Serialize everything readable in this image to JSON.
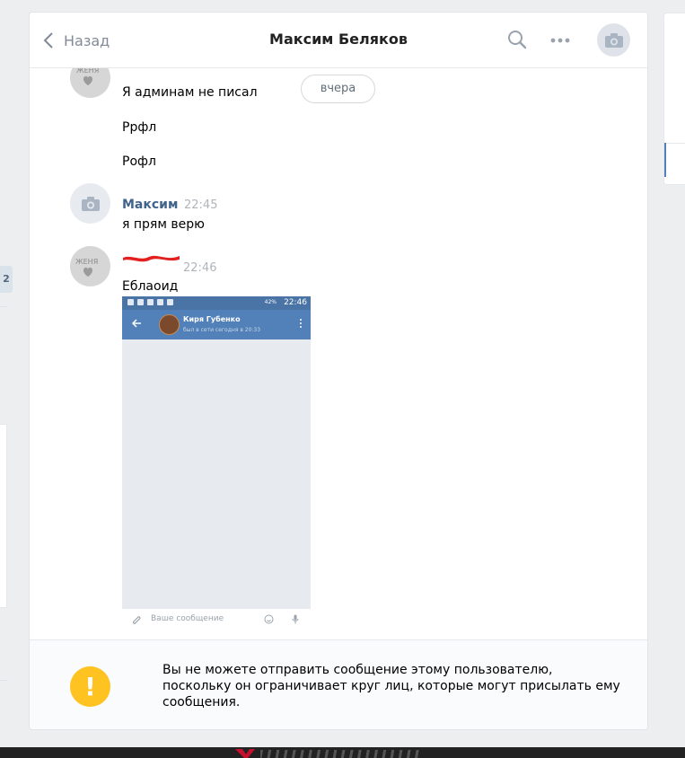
{
  "sidebar_left": {
    "badge": "2"
  },
  "header": {
    "back_label": "Назад",
    "title": "Максим Беляков",
    "icons": [
      "chevron-left-icon",
      "search-icon",
      "more-icon",
      "camera-icon"
    ]
  },
  "history": {
    "date_pill": "вчера",
    "messages": [
      {
        "text": "Я админам не писал"
      },
      {
        "text": "Ррфл"
      },
      {
        "text": "Рофл"
      },
      {
        "author": "Максим",
        "time": "22:45",
        "text": "я прям верю"
      },
      {
        "author_redacted": true,
        "time": "22:46",
        "text": "Еблаоид"
      }
    ],
    "avatar_zhenya_label": "ЖЕНЯ",
    "attachment": {
      "status_time": "22:46",
      "status_signal": "42%",
      "contact_name": "Киря Губенко",
      "contact_status": "был в сети сегодня в 20:33",
      "composer_placeholder": "Ваше сообщение"
    }
  },
  "footer": {
    "notice": "Вы не можете отправить сообщение этому пользователю, поскольку он ограничивает круг лиц, которые могут присылать ему сообщения.",
    "warn_symbol": "!"
  },
  "colors": {
    "accent": "#5181b8",
    "author": "#42648b",
    "warning": "#ffc321",
    "page_bg": "#edeef0"
  }
}
